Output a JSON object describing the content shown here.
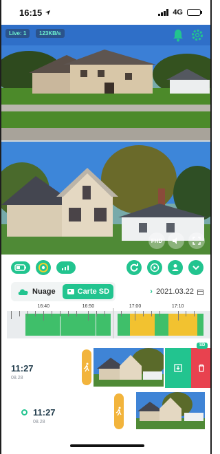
{
  "status_bar": {
    "time": "16:15",
    "network": "4G"
  },
  "live": {
    "live_badge": "Live: 1",
    "bitrate_badge": "123KB/s"
  },
  "video_controls": {
    "quality_label": "FHD",
    "mute_label": ""
  },
  "colors": {
    "accent": "#22c48f",
    "motion": "#f2b43c",
    "delete": "#e8424f"
  },
  "source_tabs": [
    {
      "label": "Nuage",
      "icon": "cloud-icon",
      "active": false
    },
    {
      "label": "Carte SD",
      "icon": "sd-card-icon",
      "active": true
    }
  ],
  "date": "2021.03.22",
  "timeline": {
    "ticks": [
      "16:40",
      "16:50",
      "17:00",
      "17:10"
    ]
  },
  "events": [
    {
      "time": "11:27",
      "date": "08.28",
      "type_icon": "motion-person-icon",
      "tag": "SD"
    },
    {
      "time": "11:27",
      "date": "08.28",
      "type_icon": "motion-person-icon"
    }
  ]
}
